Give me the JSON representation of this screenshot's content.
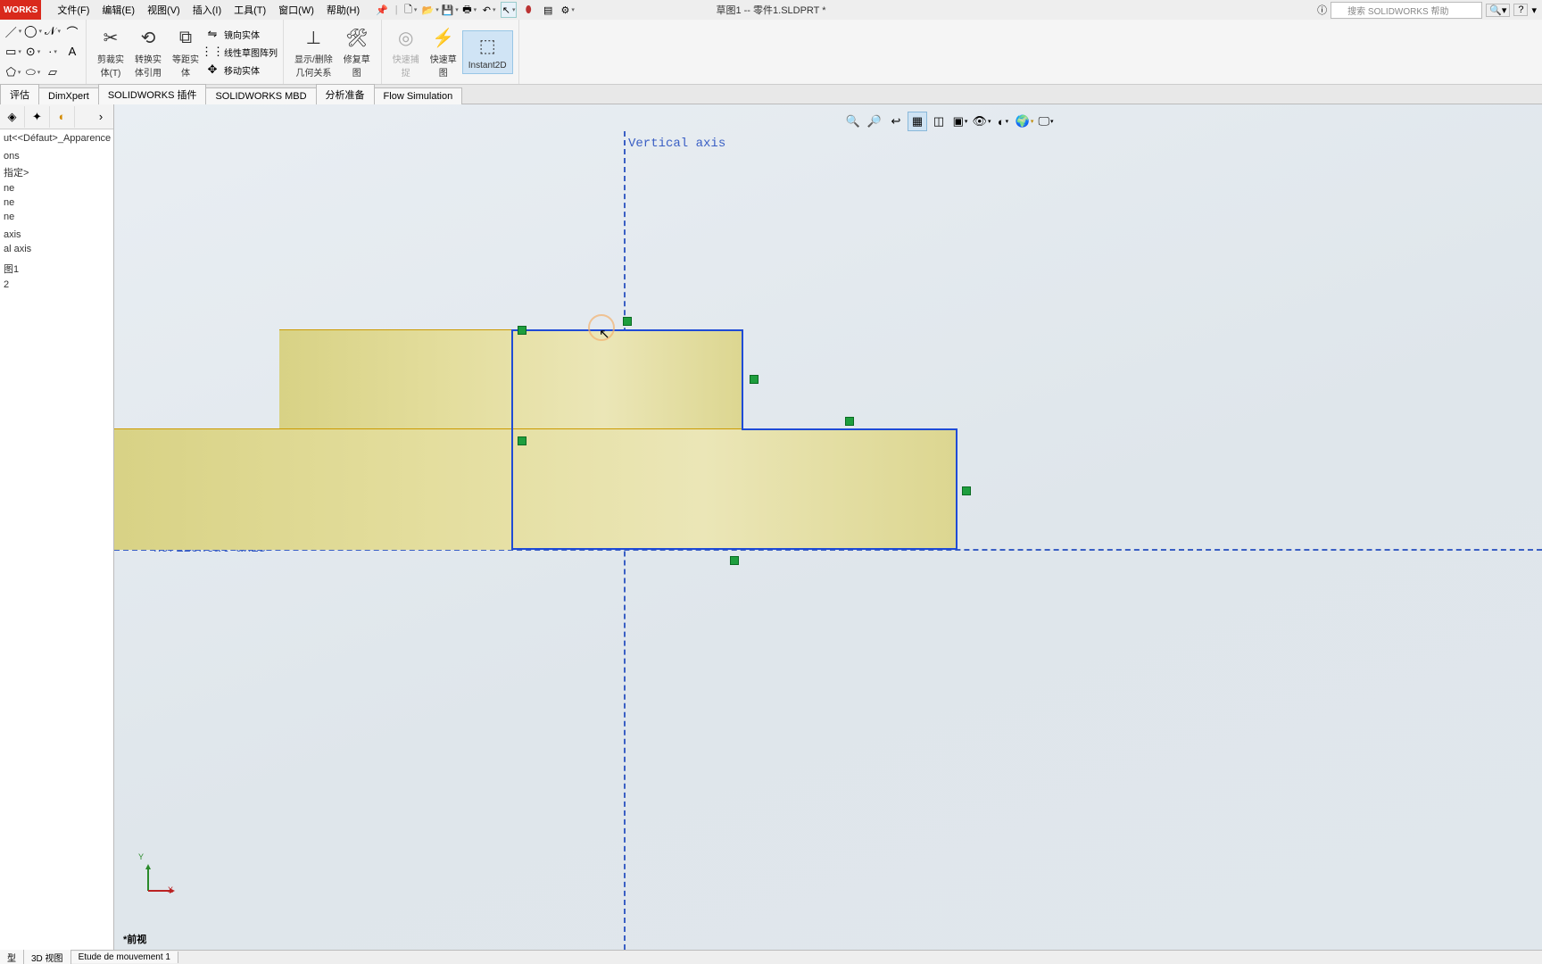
{
  "title": {
    "logo": "WORKS",
    "doc": "草图1 -- 零件1.SLDPRT *"
  },
  "menu": {
    "file": "文件(F)",
    "edit": "编辑(E)",
    "view": "视图(V)",
    "insert": "插入(I)",
    "tools": "工具(T)",
    "window": "窗口(W)",
    "help": "帮助(H)"
  },
  "search": {
    "placeholder": "搜索 SOLIDWORKS 帮助"
  },
  "help_icons": {
    "q": "?",
    "drop": "▾"
  },
  "ribbon": {
    "trim": "剪裁实\n体(T)",
    "convert": "转换实\n体引用",
    "offset": "等距实\n体",
    "mirror": "镜向实体",
    "linear": "线性草图阵列",
    "move": "移动实体",
    "showrel": "显示/删除\n几何关系",
    "repair": "修复草\n图",
    "quicksnap": "快速捕\n捉",
    "rapid": "快速草\n图",
    "instant": "Instant2D"
  },
  "tabs": {
    "eval": "评估",
    "dimx": "DimXpert",
    "plugins": "SOLIDWORKS 插件",
    "mbd": "SOLIDWORKS MBD",
    "ap": "分析准备",
    "flow": "Flow Simulation"
  },
  "tree": {
    "root": "ut<<Défaut>_Apparence Et",
    "items": [
      "",
      "ons",
      "指定>",
      "ne",
      "ne",
      "ne",
      "",
      "axis",
      "al axis",
      "",
      "图1",
      "2"
    ]
  },
  "axes": {
    "v": "Vertical axis",
    "h": "Horizontal axis"
  },
  "view_label": "*前视",
  "bottom": {
    "t1": "型",
    "t2": "3D 视图",
    "t3": "Etude de mouvement 1"
  },
  "triad": {
    "y": "Y",
    "x": "X"
  }
}
